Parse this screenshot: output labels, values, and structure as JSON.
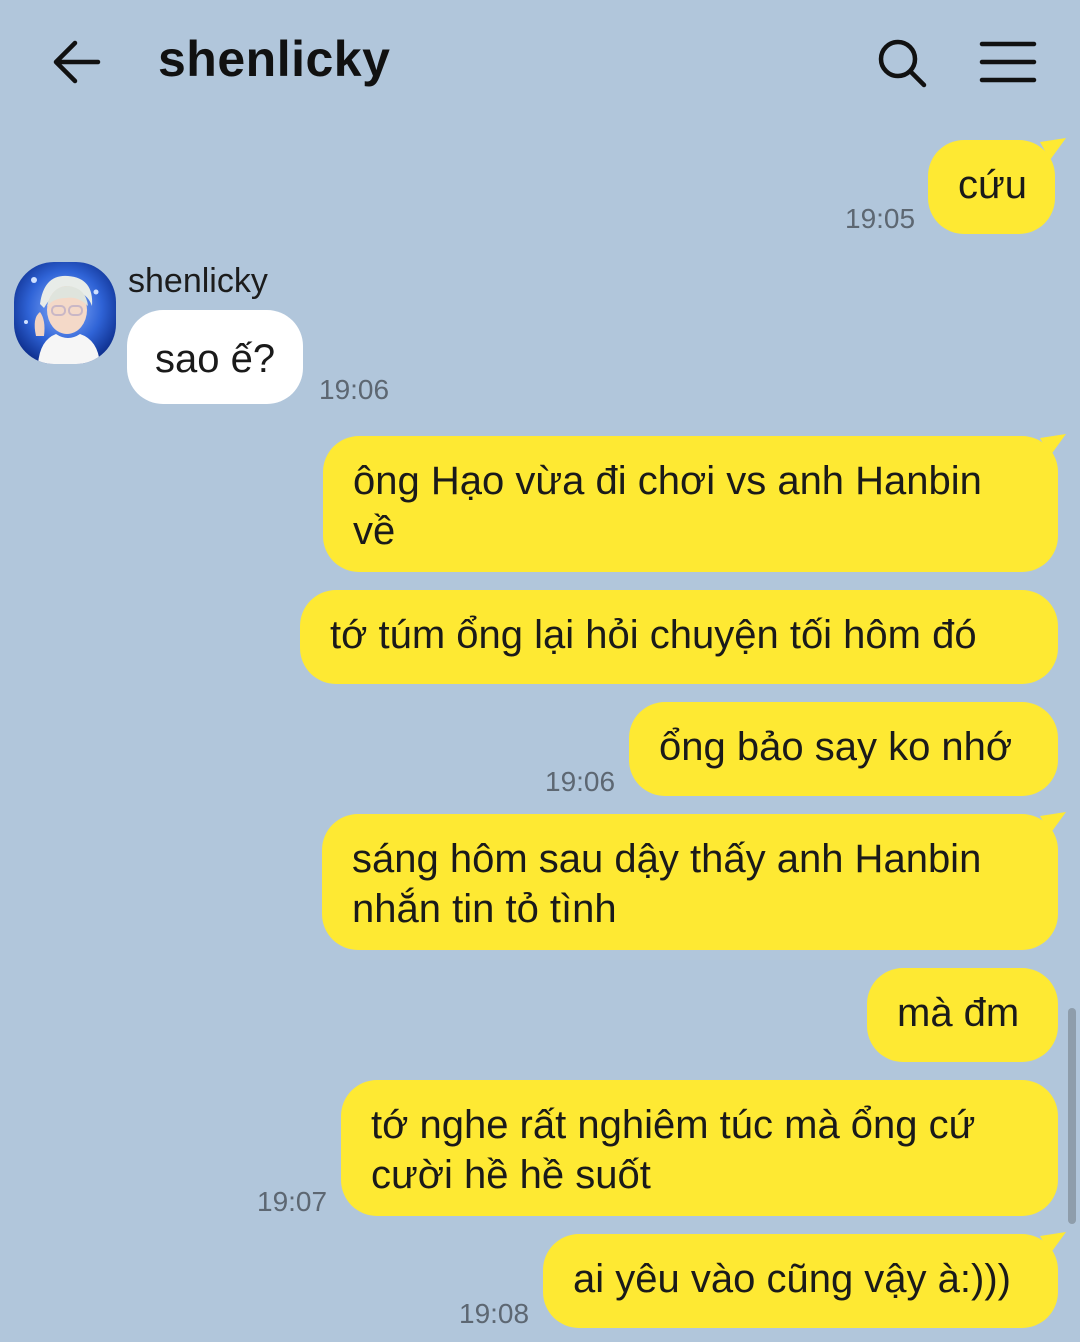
{
  "header": {
    "title": "shenlicky",
    "back_icon": "arrow-left-icon",
    "search_icon": "search-icon",
    "menu_icon": "hamburger-menu-icon"
  },
  "colors": {
    "background": "#b1c6db",
    "outgoing_bubble": "#fee933",
    "incoming_bubble": "#ffffff"
  },
  "contact": {
    "name": "shenlicky",
    "avatar_icon": "contact-avatar-photo"
  },
  "messages": [
    {
      "direction": "out",
      "text": "cứu",
      "time": "19:05"
    },
    {
      "direction": "in",
      "text": "sao ế?",
      "time": "19:06"
    },
    {
      "direction": "out",
      "text_lines": [
        "ông Hạo vừa đi chơi vs anh Hanbin",
        "về"
      ]
    },
    {
      "direction": "out",
      "text": "tớ túm ổng lại hỏi chuyện tối hôm đó"
    },
    {
      "direction": "out",
      "text": "ổng bảo say ko nhớ",
      "time": "19:06"
    },
    {
      "direction": "out",
      "text_lines": [
        "sáng hôm sau dậy thấy anh Hanbin",
        "nhắn tin tỏ tình"
      ]
    },
    {
      "direction": "out",
      "text": "mà đm"
    },
    {
      "direction": "out",
      "text_lines": [
        "tớ nghe rất nghiêm túc mà ổng cứ",
        "cười hề hề suốt"
      ],
      "time": "19:07"
    },
    {
      "direction": "out",
      "text": "ai yêu vào cũng vậy à:)))",
      "time": "19:08"
    }
  ]
}
